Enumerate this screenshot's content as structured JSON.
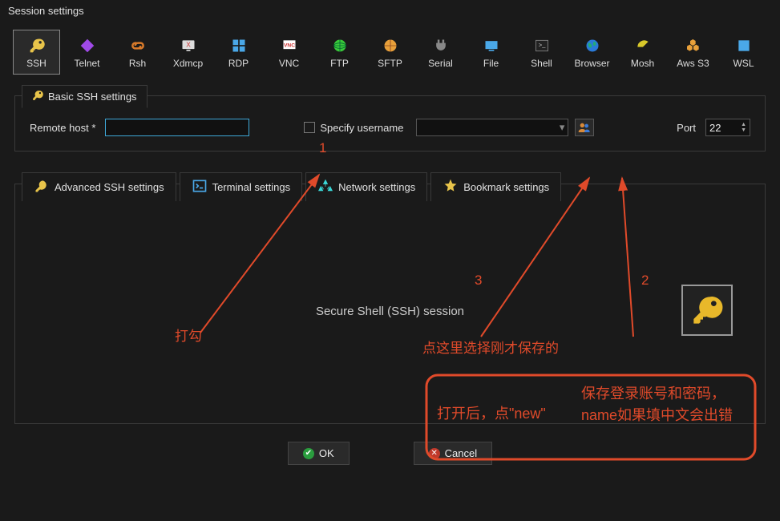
{
  "title": "Session settings",
  "session_types": [
    {
      "label": "SSH",
      "icon": "key",
      "color": "#e8c44a",
      "selected": true
    },
    {
      "label": "Telnet",
      "icon": "diamond",
      "color": "#a04ae8"
    },
    {
      "label": "Rsh",
      "icon": "link",
      "color": "#d87a2a"
    },
    {
      "label": "Xdmcp",
      "icon": "monitor-x",
      "color": "#4a7ae8"
    },
    {
      "label": "RDP",
      "icon": "windows",
      "color": "#4aa8e8"
    },
    {
      "label": "VNC",
      "icon": "vnc",
      "color": "#e84a4a"
    },
    {
      "label": "FTP",
      "icon": "globe",
      "color": "#3ac83a"
    },
    {
      "label": "SFTP",
      "icon": "globe-lock",
      "color": "#e8a03a"
    },
    {
      "label": "Serial",
      "icon": "plug",
      "color": "#888"
    },
    {
      "label": "File",
      "icon": "file-mon",
      "color": "#4aa8e8"
    },
    {
      "label": "Shell",
      "icon": "prompt",
      "color": "#ccc"
    },
    {
      "label": "Browser",
      "icon": "earth",
      "color": "#2a7ad8"
    },
    {
      "label": "Mosh",
      "icon": "dish",
      "color": "#d8c82a"
    },
    {
      "label": "Aws S3",
      "icon": "cubes",
      "color": "#e8a03a"
    },
    {
      "label": "WSL",
      "icon": "win-square",
      "color": "#4aa8e8"
    }
  ],
  "basic": {
    "tab_label": "Basic SSH settings",
    "remote_host_label": "Remote host *",
    "remote_host_value": "",
    "specify_username_label": "Specify username",
    "specify_username_checked": false,
    "username_value": "",
    "port_label": "Port",
    "port_value": "22"
  },
  "lower_tabs": [
    {
      "label": "Advanced SSH settings",
      "icon": "key-icon",
      "color": "#e8c44a"
    },
    {
      "label": "Terminal settings",
      "icon": "terminal-icon",
      "color": "#4aa8e8"
    },
    {
      "label": "Network settings",
      "icon": "net-icon",
      "color": "#3ad8d8"
    },
    {
      "label": "Bookmark settings",
      "icon": "star-icon",
      "color": "#e8c44a"
    }
  ],
  "session_heading": "Secure Shell (SSH) session",
  "buttons": {
    "ok": "OK",
    "cancel": "Cancel"
  },
  "annotations": {
    "n1": "1",
    "n2": "2",
    "n3": "3",
    "check": "打勾",
    "select_saved": "点这里选择刚才保存的",
    "open_new": "打开后，点\"new\"",
    "save_note": "保存登录账号和密码，name如果填中文会出错"
  }
}
